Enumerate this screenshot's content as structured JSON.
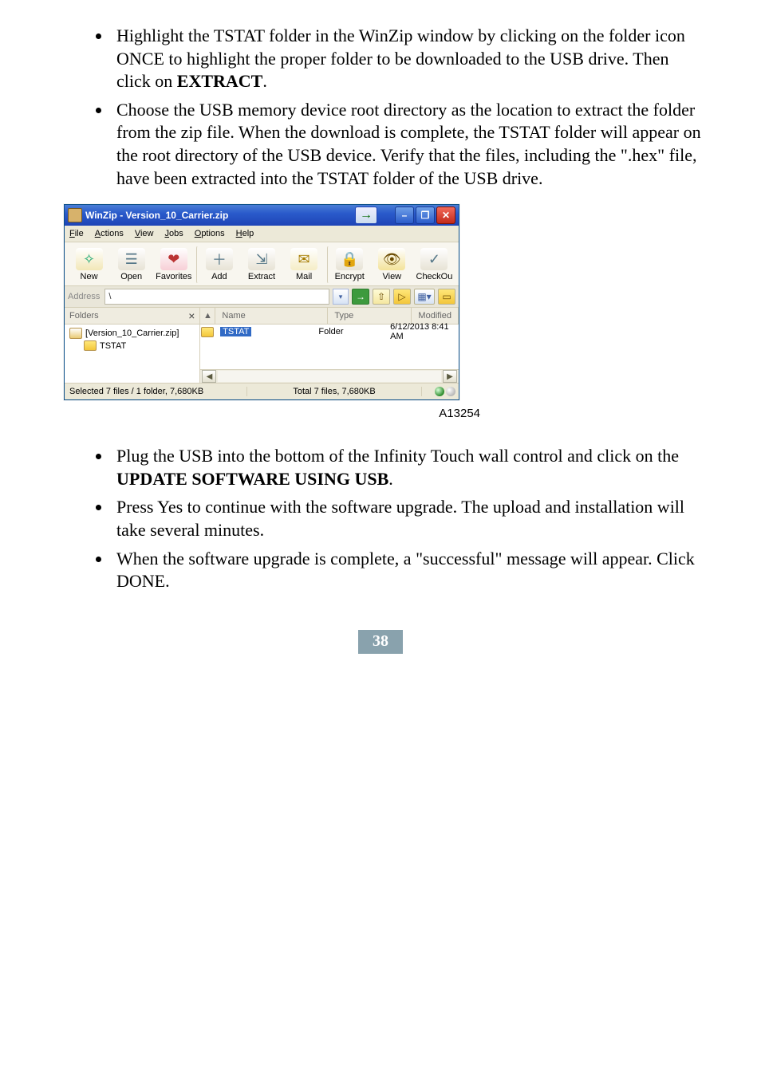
{
  "bullets_top": [
    {
      "pre": "Highlight the TSTAT folder in the WinZip window by clicking on the folder icon ONCE to highlight the proper folder to be downloaded to the USB drive. Then click on ",
      "bold": "EXTRACT",
      "post": "."
    },
    {
      "pre": "Choose the USB memory device root directory as the location to extract the folder from the zip file. When the download is complete, the TSTAT folder will appear on the root directory of the USB device. Verify that the files, including the \".hex\" file, have been extracted into the TSTAT folder of the USB drive.",
      "bold": "",
      "post": ""
    }
  ],
  "figure_label": "A13254",
  "winzip": {
    "title": "WinZip - Version_10_Carrier.zip",
    "arrow_glyph": "→",
    "win_min": "–",
    "win_max": "❐",
    "win_close": "✕",
    "menu": [
      "File",
      "Actions",
      "View",
      "Jobs",
      "Options",
      "Help"
    ],
    "toolbar": [
      "New",
      "Open",
      "Favorites",
      "Add",
      "Extract",
      "Mail",
      "Encrypt",
      "View",
      "CheckOu"
    ],
    "address_label": "Address",
    "address_value": "\\",
    "dd_glyph": "▾",
    "go_glyph": "→",
    "up_glyph": "⇧",
    "open_glyph": "▷",
    "views_glyph": "▦▾",
    "folder_glyph": "📁",
    "folders_label": "Folders",
    "folders_close": "×",
    "tree_root": "[Version_10_Carrier.zip]",
    "tree_child": "TSTAT",
    "cols": {
      "sort": "▲",
      "name": "Name",
      "type": "Type",
      "modified": "Modified"
    },
    "row": {
      "name": "TSTAT",
      "type": "Folder",
      "modified": "6/12/2013 8:41 AM"
    },
    "scroll_left": "◀",
    "scroll_mid": "▯",
    "scroll_right": "▶",
    "status_left": "Selected 7 files / 1 folder, 7,680KB",
    "status_center": "Total 7 files, 7,680KB"
  },
  "bullets_bottom": [
    {
      "pre": "Plug the USB into the bottom of the Infinity Touch wall control and click on the ",
      "bold": "UPDATE SOFTWARE USING USB",
      "post": "."
    },
    {
      "pre": "Press Yes to continue with the software upgrade. The upload and installation will take several minutes.",
      "bold": "",
      "post": ""
    },
    {
      "pre": "When the software upgrade is complete, a \"successful\" message will appear. Click DONE.",
      "bold": "",
      "post": ""
    }
  ],
  "page_number": "38"
}
